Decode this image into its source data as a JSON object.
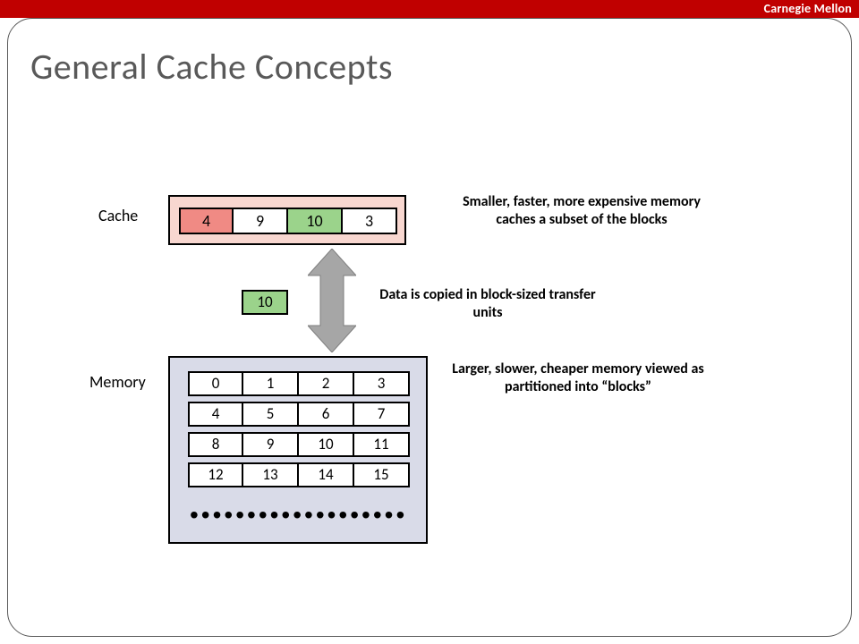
{
  "brand": "Carnegie Mellon",
  "title": "General Cache Concepts",
  "labels": {
    "cache": "Cache",
    "memory": "Memory"
  },
  "cache": {
    "blocks": [
      "4",
      "9",
      "10",
      "3"
    ],
    "highlight_red": 0,
    "highlight_green": 2
  },
  "transfer": {
    "value": "10"
  },
  "memory": {
    "rows": [
      [
        "0",
        "1",
        "2",
        "3"
      ],
      [
        "4",
        "5",
        "6",
        "7"
      ],
      [
        "8",
        "9",
        "10",
        "11"
      ],
      [
        "12",
        "13",
        "14",
        "15"
      ]
    ],
    "highlight_red": {
      "row": 1,
      "col": 0
    },
    "highlight_green": {
      "row": 2,
      "col": 2
    }
  },
  "captions": {
    "cache": "Smaller, faster, more expensive memory caches a subset of the blocks",
    "transfer": "Data is copied in block-sized transfer units",
    "memory": "Larger, slower, cheaper memory viewed as partitioned into “blocks”"
  },
  "dots": "•••••••••••••••••••"
}
